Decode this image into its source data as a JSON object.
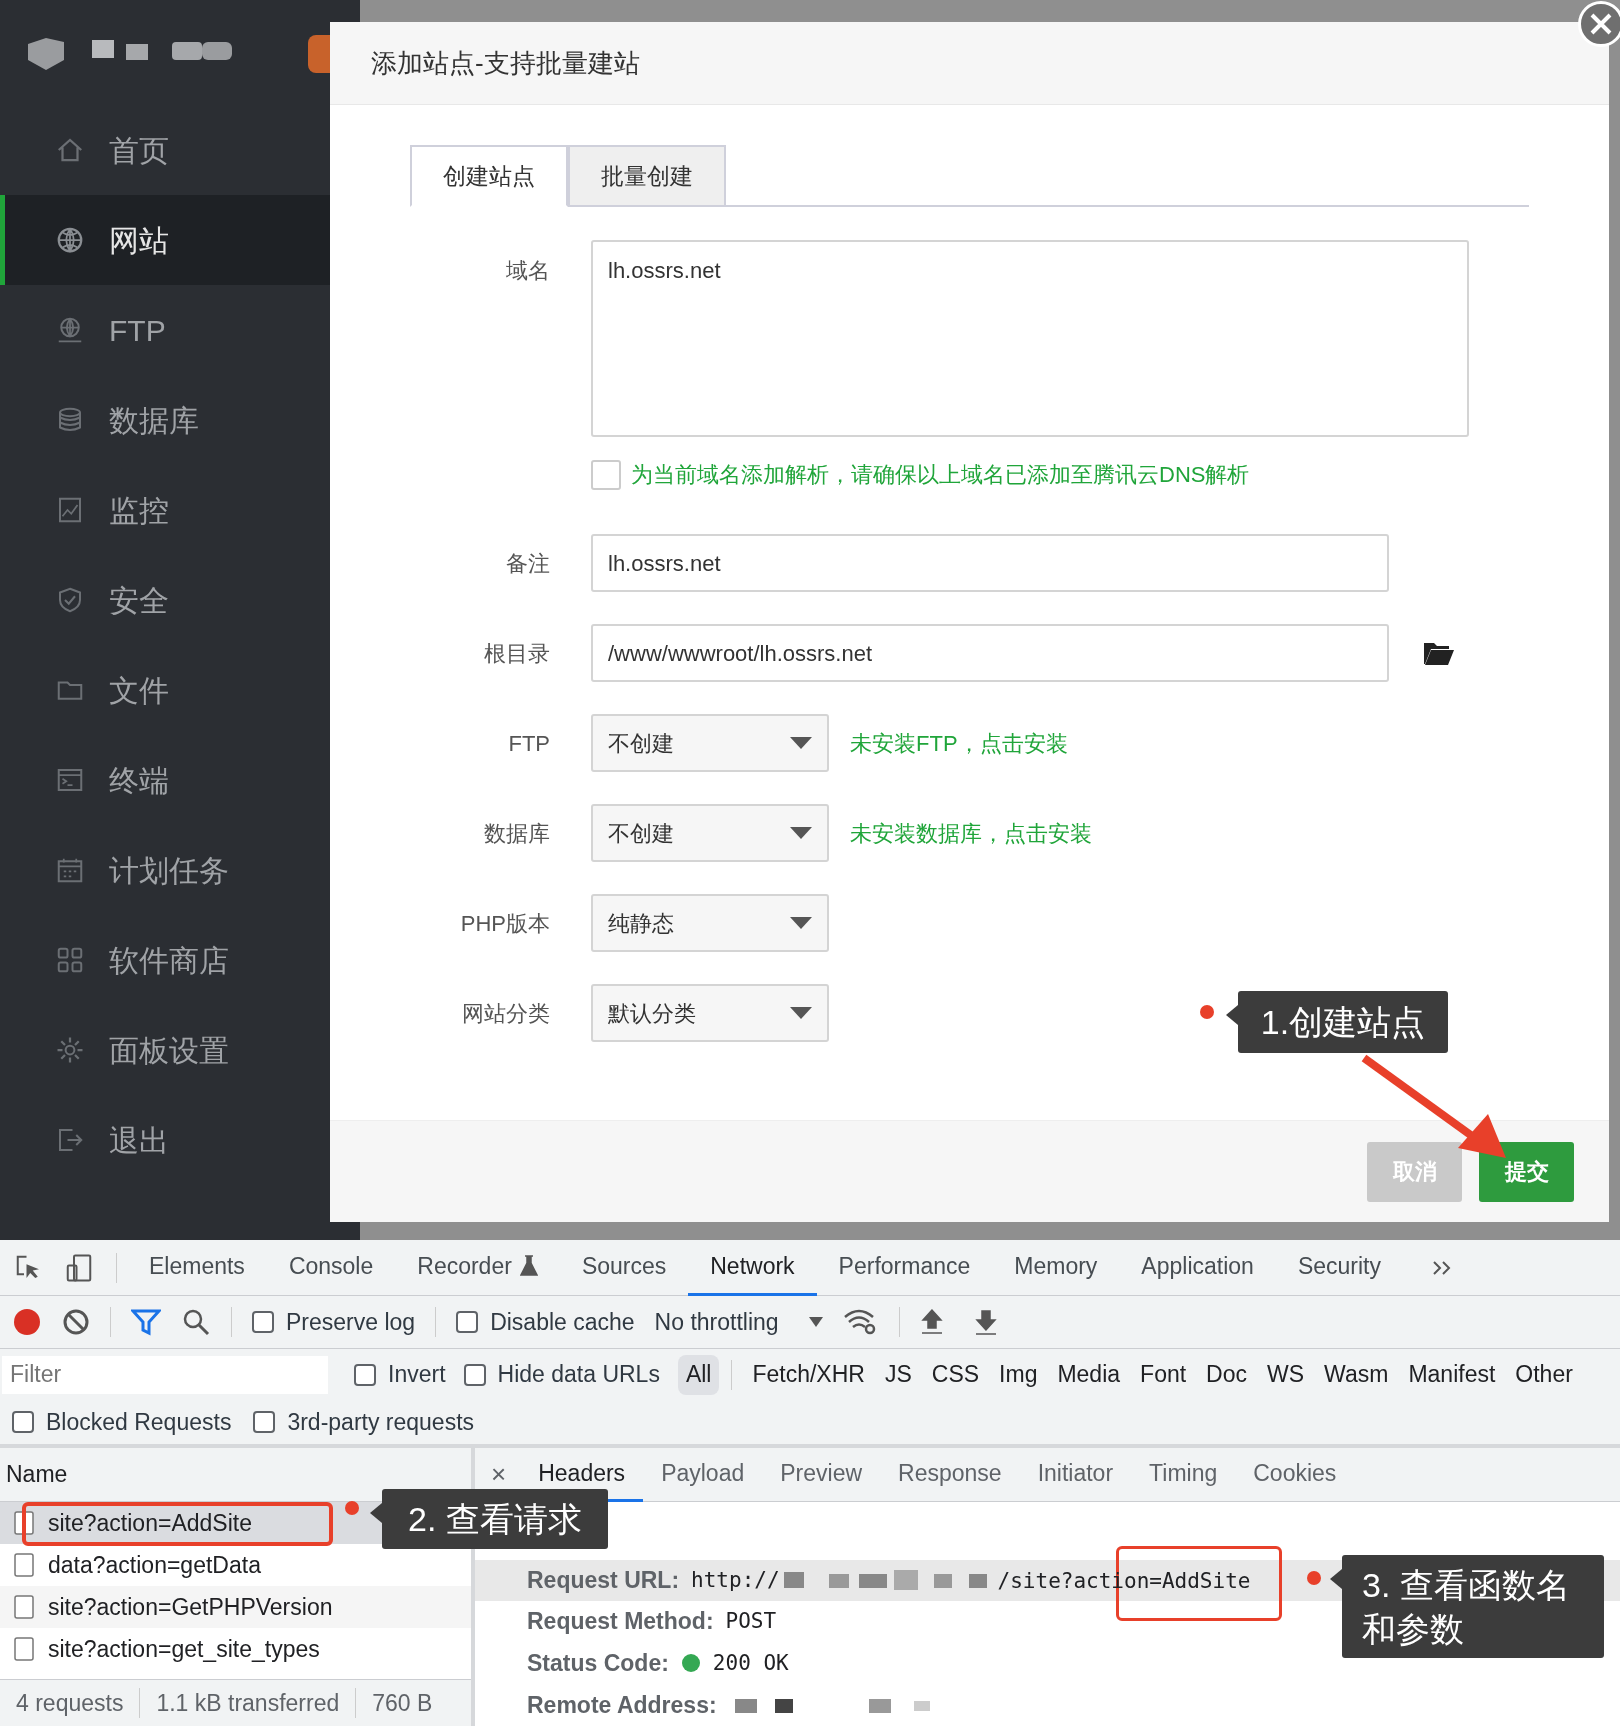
{
  "sidebar": {
    "items": [
      {
        "label": "首页",
        "selected": false
      },
      {
        "label": "网站",
        "selected": true
      },
      {
        "label": "FTP",
        "selected": false
      },
      {
        "label": "数据库",
        "selected": false
      },
      {
        "label": "监控",
        "selected": false
      },
      {
        "label": "安全",
        "selected": false
      },
      {
        "label": "文件",
        "selected": false
      },
      {
        "label": "终端",
        "selected": false
      },
      {
        "label": "计划任务",
        "selected": false
      },
      {
        "label": "软件商店",
        "selected": false
      },
      {
        "label": "面板设置",
        "selected": false
      },
      {
        "label": "退出",
        "selected": false
      }
    ]
  },
  "dialog": {
    "title": "添加站点-支持批量建站",
    "tabs": [
      {
        "label": "创建站点",
        "selected": true
      },
      {
        "label": "批量创建",
        "selected": false
      }
    ],
    "fields": [
      {
        "kind": "textarea",
        "label": "域名",
        "value": "lh.ossrs.net"
      },
      {
        "kind": "checkbox",
        "label": "为当前域名添加解析，请确保以上域名已添加至腾讯云DNS解析",
        "checked": false
      },
      {
        "kind": "text",
        "label": "备注",
        "value": "lh.ossrs.net"
      },
      {
        "kind": "path",
        "label": "根目录",
        "value": "/www/wwwroot/lh.ossrs.net"
      },
      {
        "kind": "select",
        "label": "FTP",
        "value": "不创建",
        "hint": "未安装FTP，点击安装"
      },
      {
        "kind": "select",
        "label": "数据库",
        "value": "不创建",
        "hint": "未安装数据库，点击安装"
      },
      {
        "kind": "select",
        "label": "PHP版本",
        "value": "纯静态"
      },
      {
        "kind": "select",
        "label": "网站分类",
        "value": "默认分类"
      }
    ],
    "buttons": [
      {
        "label": "取消",
        "kind": "secondary"
      },
      {
        "label": "提交",
        "kind": "primary"
      }
    ]
  },
  "devtools": {
    "tabs": [
      {
        "label": "Elements",
        "selected": false
      },
      {
        "label": "Console",
        "selected": false
      },
      {
        "label": "Recorder",
        "selected": false
      },
      {
        "label": "Sources",
        "selected": false
      },
      {
        "label": "Network",
        "selected": true
      },
      {
        "label": "Performance",
        "selected": false
      },
      {
        "label": "Memory",
        "selected": false
      },
      {
        "label": "Application",
        "selected": false
      },
      {
        "label": "Security",
        "selected": false
      }
    ],
    "toolbar": {
      "preserve_log": {
        "label": "Preserve log",
        "checked": false
      },
      "disable_cache": {
        "label": "Disable cache",
        "checked": false
      },
      "throttling": "No throttling"
    },
    "filter": {
      "placeholder": "Filter",
      "invert": {
        "label": "Invert",
        "checked": false
      },
      "hide_data_urls": {
        "label": "Hide data URLs",
        "checked": false
      },
      "types": [
        {
          "label": "All",
          "selected": true
        },
        {
          "label": "Fetch/XHR",
          "selected": false
        },
        {
          "label": "JS",
          "selected": false
        },
        {
          "label": "CSS",
          "selected": false
        },
        {
          "label": "Img",
          "selected": false
        },
        {
          "label": "Media",
          "selected": false
        },
        {
          "label": "Font",
          "selected": false
        },
        {
          "label": "Doc",
          "selected": false
        },
        {
          "label": "WS",
          "selected": false
        },
        {
          "label": "Wasm",
          "selected": false
        },
        {
          "label": "Manifest",
          "selected": false
        },
        {
          "label": "Other",
          "selected": false
        }
      ]
    },
    "options": [
      {
        "label": "Blocked Requests",
        "checked": false
      },
      {
        "label": "3rd-party requests",
        "checked": false
      }
    ],
    "requests": {
      "column": "Name",
      "rows": [
        {
          "name": "site?action=AddSite",
          "selected": true
        },
        {
          "name": "data?action=getData",
          "selected": false
        },
        {
          "name": "site?action=GetPHPVersion",
          "selected": false
        },
        {
          "name": "site?action=get_site_types",
          "selected": false
        }
      ]
    },
    "status_bar": [
      "4 requests",
      "1.1 kB transferred",
      "760 B"
    ],
    "detail": {
      "close": "×",
      "tabs": [
        {
          "label": "Headers",
          "selected": true
        },
        {
          "label": "Payload",
          "selected": false
        },
        {
          "label": "Preview",
          "selected": false
        },
        {
          "label": "Response",
          "selected": false
        },
        {
          "label": "Initiator",
          "selected": false
        },
        {
          "label": "Timing",
          "selected": false
        },
        {
          "label": "Cookies",
          "selected": false
        }
      ],
      "rows": [
        {
          "label": "Request URL:",
          "prefix": "http://",
          "value": "/site?action=AddSite",
          "kind": "url"
        },
        {
          "label": "Request Method:",
          "value": "POST",
          "kind": "plain"
        },
        {
          "label": "Status Code:",
          "value": "200 OK",
          "kind": "status"
        },
        {
          "label": "Remote Address:",
          "kind": "hidden"
        }
      ]
    }
  },
  "annotations": [
    "1.创建站点",
    "2. 查看请求",
    "3. 查看函数名和参数"
  ]
}
